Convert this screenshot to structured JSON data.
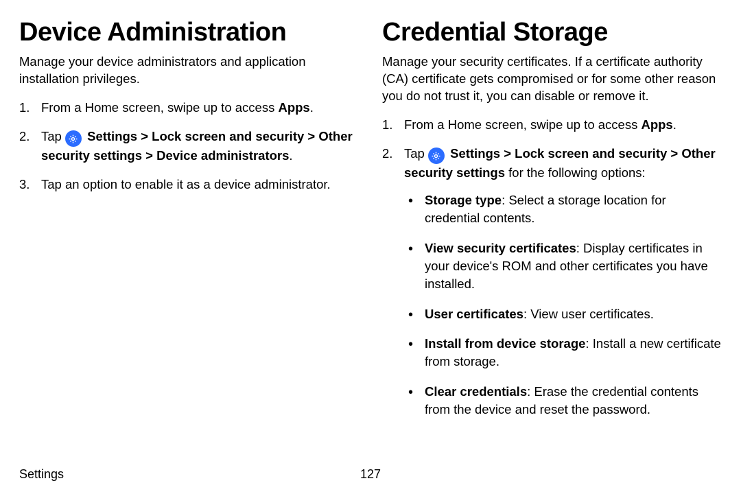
{
  "left": {
    "heading": "Device Administration",
    "intro": "Manage your device administrators and application installation privileges.",
    "step1_pre": "From a Home screen, swipe up to access ",
    "step1_bold": "Apps",
    "step1_post": ".",
    "step2_pre": "Tap ",
    "step2_path": "Settings > Lock screen and security > Other security settings > Device administrators",
    "step2_post": ".",
    "step3": "Tap an option to enable it as a device administrator."
  },
  "right": {
    "heading": "Credential Storage",
    "intro": "Manage your security certificates. If a certificate authority (CA) certificate gets compromised or for some other reason you do not trust it, you can disable or remove it.",
    "step1_pre": "From a Home screen, swipe up to access ",
    "step1_bold": "Apps",
    "step1_post": ".",
    "step2_pre": "Tap ",
    "step2_path": "Settings > Lock screen and security > Other security settings",
    "step2_post": " for the following options:",
    "bullets": [
      {
        "bold": "Storage type",
        "text": ": Select a storage location for credential contents."
      },
      {
        "bold": "View security certificates",
        "text": ": Display certificates in your device's ROM and other certificates you have installed."
      },
      {
        "bold": "User certificates",
        "text": ": View user certificates."
      },
      {
        "bold": "Install from device storage",
        "text": ": Install a new certificate from storage."
      },
      {
        "bold": "Clear credentials",
        "text": ": Erase the credential contents from the device and reset the password."
      }
    ]
  },
  "footer": {
    "section": "Settings",
    "page": "127"
  }
}
